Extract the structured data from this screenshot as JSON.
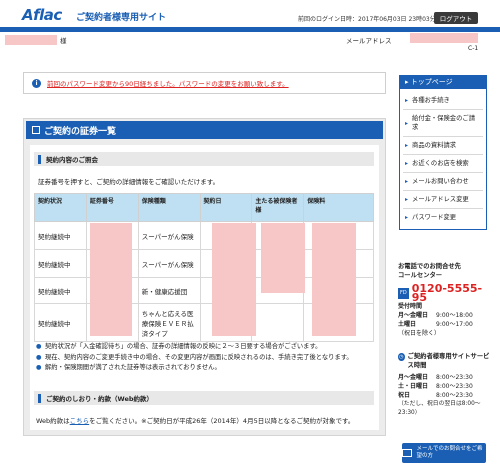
{
  "header": {
    "logo": "Aflac",
    "site_title": "ご契約者様専用サイト",
    "last_login": "前回のログイン日時：2017年06月03日 23時03分",
    "logout_label": "ログアウト",
    "name_suffix": "様",
    "email_label": "メールアドレス",
    "page_code": "C-1"
  },
  "alert": {
    "icon": "i",
    "text": "前回のパスワード変更から90日経ちました。パスワードの変更をお願い致します。"
  },
  "main": {
    "title": "ご契約の証券一覧",
    "section1_title": "契約内容のご照会",
    "instruction": "証券番号を押すと、ご契約の詳細情報をご確認いただけます。",
    "table": {
      "headers": [
        "契約状況",
        "証券番号",
        "保険種類",
        "契約日",
        "主たる被保険者様",
        "保険料"
      ],
      "rows": [
        {
          "status": "契約継続中",
          "type": "スーパーがん保険"
        },
        {
          "status": "契約継続中",
          "type": "スーパーがん保険"
        },
        {
          "status": "契約継続中",
          "type": "新・健康応援団"
        },
        {
          "status": "契約継続中",
          "type": "ちゃんと応える医療保険ＥＶＥＲ払済タイプ"
        }
      ]
    },
    "notes": [
      "契約状況が「入金確認待ち」の場合、証券の詳細情報の反映に２～３日要する場合がございます。",
      "現在、契約内容のご変更手続き中の場合、その変更内容が画面に反映されるのは、手続き完了後となります。",
      "解約・保険期間が満了された証券等は表示されておりません。"
    ],
    "section2_title": "ご契約のしおり・約款（Web約款）",
    "web_terms_prefix": "Web約款は",
    "web_terms_link": "こちら",
    "web_terms_suffix": "をご覧ください。※ご契約日が平成26年（2014年）4月5日以降となるご契約が対象です。"
  },
  "sidebar": {
    "top_label": "トップページ",
    "items": [
      "各種お手続き",
      "給付金・保険金のご請求",
      "商品の資料請求",
      "お近くのお店を検索",
      "メールお問い合わせ",
      "メールアドレス変更",
      "パスワード変更"
    ],
    "contact": {
      "intro": "お電話でのお問合せ先",
      "center": "コールセンター",
      "fd": "FD",
      "phone": "0120-5555-95",
      "hours_label": "受付時間",
      "hours": [
        [
          "月～金曜日",
          "9:00～18:00"
        ],
        [
          "土曜日",
          "9:00～17:00"
        ]
      ],
      "hours_note": "（祝日を除く）"
    },
    "service": {
      "title": "ご契約者様専用サイトサービス時間",
      "hours": [
        [
          "月～金曜日",
          "8:00～23:30"
        ],
        [
          "土・日曜日",
          "8:00～23:30"
        ],
        [
          "祝日",
          "8:00～23:30"
        ]
      ],
      "note": "（ただし、祝日の翌日は8:00～23:30）"
    },
    "mail_button": "メールでのお問合せをご希望の方"
  }
}
